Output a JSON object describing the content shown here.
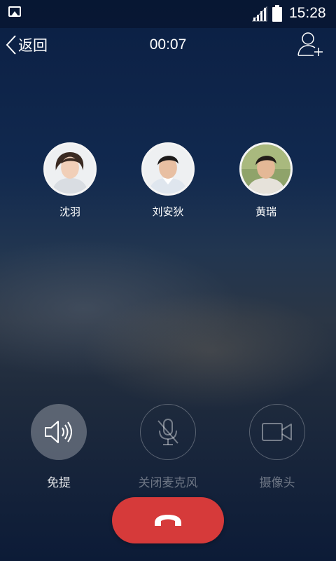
{
  "status_bar": {
    "time": "15:28",
    "icons": [
      "gallery-icon",
      "signal-icon",
      "battery-icon"
    ]
  },
  "header": {
    "back_label": "返回",
    "call_duration": "00:07",
    "add_participant_icon": "add-user-icon"
  },
  "participants": [
    {
      "name": "沈羽"
    },
    {
      "name": "刘安狄"
    },
    {
      "name": "黄瑞"
    }
  ],
  "controls": [
    {
      "label": "免提",
      "icon": "speaker-icon",
      "active": true
    },
    {
      "label": "关闭麦克风",
      "icon": "mic-off-icon",
      "active": false
    },
    {
      "label": "摄像头",
      "icon": "camera-icon",
      "active": false
    }
  ],
  "end_call": {
    "icon": "hang-up-icon",
    "color": "#d63a3a"
  },
  "colors": {
    "background_top": "#0b1f43",
    "background_bottom": "#0c1b37",
    "end_call": "#d63a3a"
  }
}
